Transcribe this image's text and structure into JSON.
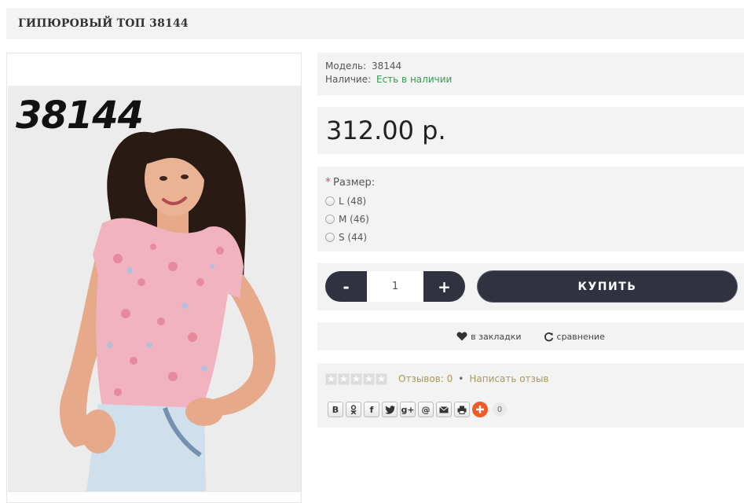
{
  "product": {
    "title": "ГИПЮРОВЫЙ ТОП 38144",
    "image_label": "38144",
    "model_label": "Модель:",
    "model_value": "38144",
    "stock_label": "Наличие:",
    "stock_value": "Есть в наличии",
    "price": "312.00 р."
  },
  "options": {
    "required_mark": "*",
    "size_label": "Размер:",
    "sizes": [
      "L (48)",
      "M (46)",
      "S (44)"
    ]
  },
  "cart": {
    "minus_label": "-",
    "quantity": "1",
    "plus_label": "+",
    "buy_label": "КУПИТЬ"
  },
  "actions": {
    "wishlist_label": "в закладки",
    "compare_label": "сравнение"
  },
  "reviews": {
    "rating_stars": 0,
    "max_stars": 5,
    "reviews_count_label": "Отзывов: 0",
    "separator": "•",
    "write_review_label": "Написать отзыв"
  },
  "share": {
    "buttons": [
      "В",
      "ok",
      "f",
      "twitter",
      "g+",
      "@",
      "mail",
      "print"
    ],
    "count": "0"
  },
  "colors": {
    "accent_dark": "#30333f",
    "in_stock": "#2e9e4f",
    "review_link": "#a89a55",
    "share_plus": "#f05a28",
    "panel_bg": "#f3f3f3"
  }
}
